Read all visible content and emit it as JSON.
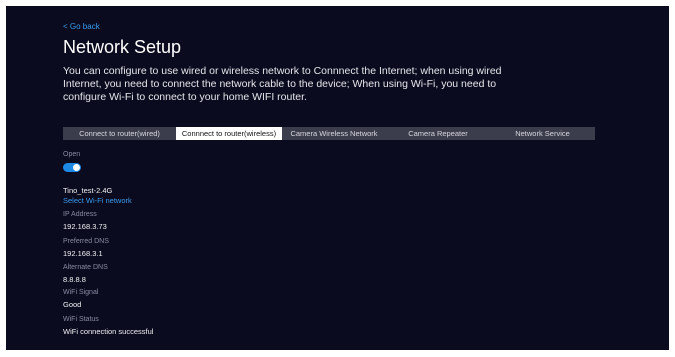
{
  "header": {
    "back_label": "< Go back",
    "title": "Network Setup",
    "description": "You can configure to use wired or wireless network to Connnect the Internet; when using wired Internet, you need to connect the network cable to the device; When using Wi-Fi, you need to configure Wi-Fi to connect to your home WIFI router."
  },
  "tabs": [
    {
      "label": "Connect to router(wired)",
      "active": false
    },
    {
      "label": "Connnect to router(wireless)",
      "active": true
    },
    {
      "label": "Camera Wireless Network",
      "active": false
    },
    {
      "label": "Camera Repeater",
      "active": false
    },
    {
      "label": "Network Service",
      "active": false
    }
  ],
  "wireless": {
    "open_label": "Open",
    "open_enabled": true,
    "network_name": "Tino_test-2.4G",
    "select_network_label": "Select Wi-Fi network",
    "ip_address_label": "IP Address",
    "ip_address": "192.168.3.73",
    "preferred_dns_label": "Preferred DNS",
    "preferred_dns": "192.168.3.1",
    "alternate_dns_label": "Alternate DNS",
    "alternate_dns": "8.8.8.8",
    "wifi_signal_label": "WiFi Signal",
    "wifi_signal": "Good",
    "wifi_status_label": "WiFi Status",
    "wifi_status": "WiFi connection successful"
  },
  "colors": {
    "background": "#0a0b1e",
    "accent": "#1e88e5",
    "link": "#3a9bf0",
    "tab_bar": "#3b3d4c",
    "tab_active": "#ffffff"
  }
}
